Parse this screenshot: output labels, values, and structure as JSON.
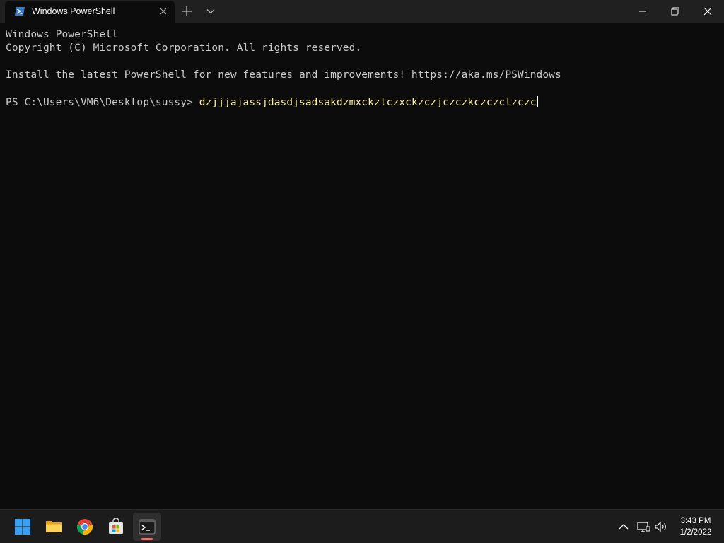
{
  "window": {
    "tab_title": "Windows PowerShell",
    "controls": [
      "minimize",
      "maximize",
      "close"
    ]
  },
  "terminal": {
    "line1": "Windows PowerShell",
    "line2": "Copyright (C) Microsoft Corporation. All rights reserved.",
    "line3": "Install the latest PowerShell for new features and improvements! https://aka.ms/PSWindows",
    "prompt": "PS C:\\Users\\VM6\\Desktop\\sussy> ",
    "command": "dzjjjajassjdasdjsadsakdzmxckzlczxckzczjczczkczczclzczc",
    "colors": {
      "background": "#0c0c0c",
      "text": "#cccccc",
      "command": "#f9f1a5"
    }
  },
  "taskbar": {
    "apps": [
      "start-icon",
      "file-explorer-icon",
      "chrome-icon",
      "microsoft-store-icon",
      "terminal-icon"
    ],
    "active_app": "terminal-icon",
    "tray_icons": [
      "chevron-up-icon",
      "network-icon",
      "volume-icon"
    ],
    "time": "3:43 PM",
    "date": "1/2/2022"
  }
}
